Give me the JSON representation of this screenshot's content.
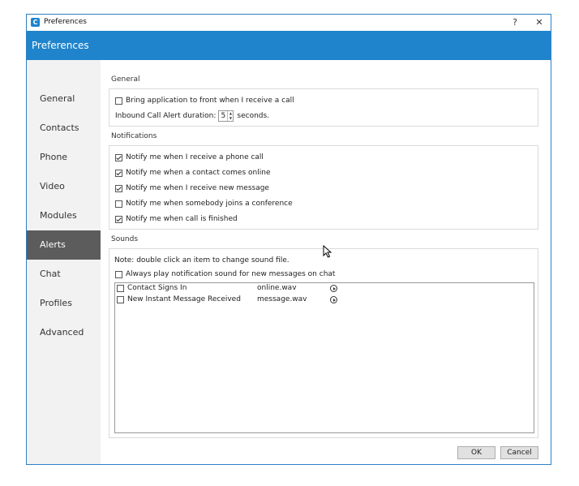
{
  "window": {
    "title": "Preferences",
    "help_label": "?",
    "close_label": "✕",
    "header_title": "Preferences",
    "icon_letter": "C"
  },
  "sidebar": {
    "items": [
      {
        "label": "General",
        "active": false
      },
      {
        "label": "Contacts",
        "active": false
      },
      {
        "label": "Phone",
        "active": false
      },
      {
        "label": "Video",
        "active": false
      },
      {
        "label": "Modules",
        "active": false
      },
      {
        "label": "Alerts",
        "active": true
      },
      {
        "label": "Chat",
        "active": false
      },
      {
        "label": "Profiles",
        "active": false
      },
      {
        "label": "Advanced",
        "active": false
      }
    ]
  },
  "general": {
    "section_label": "General",
    "bring_to_front": {
      "label": "Bring application to front when I receive a call",
      "checked": false
    },
    "duration": {
      "prefix": "Inbound Call Alert duration:",
      "value": "5",
      "suffix": "seconds."
    }
  },
  "notifications": {
    "section_label": "Notifications",
    "items": [
      {
        "label": "Notify me when I receive a phone call",
        "checked": true
      },
      {
        "label": "Notify me when a contact comes online",
        "checked": true
      },
      {
        "label": "Notify me when I receive new message",
        "checked": true
      },
      {
        "label": "Notify me when somebody joins a conference",
        "checked": false
      },
      {
        "label": "Notify me when call is finished",
        "checked": true
      }
    ]
  },
  "sounds": {
    "section_label": "Sounds",
    "note": "Note: double click an item to change sound file.",
    "always_play": {
      "label": "Always play notification sound for new messages on chat",
      "checked": false
    },
    "rows": [
      {
        "name": "Contact Signs In",
        "file": "online.wav",
        "checked": false
      },
      {
        "name": "New Instant Message Received",
        "file": "message.wav",
        "checked": false
      }
    ]
  },
  "footer": {
    "ok_label": "OK",
    "cancel_label": "Cancel"
  },
  "colors": {
    "accent": "#1f84cc",
    "sidebar_active": "#5c5c5c",
    "sidebar_bg": "#f2f2f2"
  }
}
